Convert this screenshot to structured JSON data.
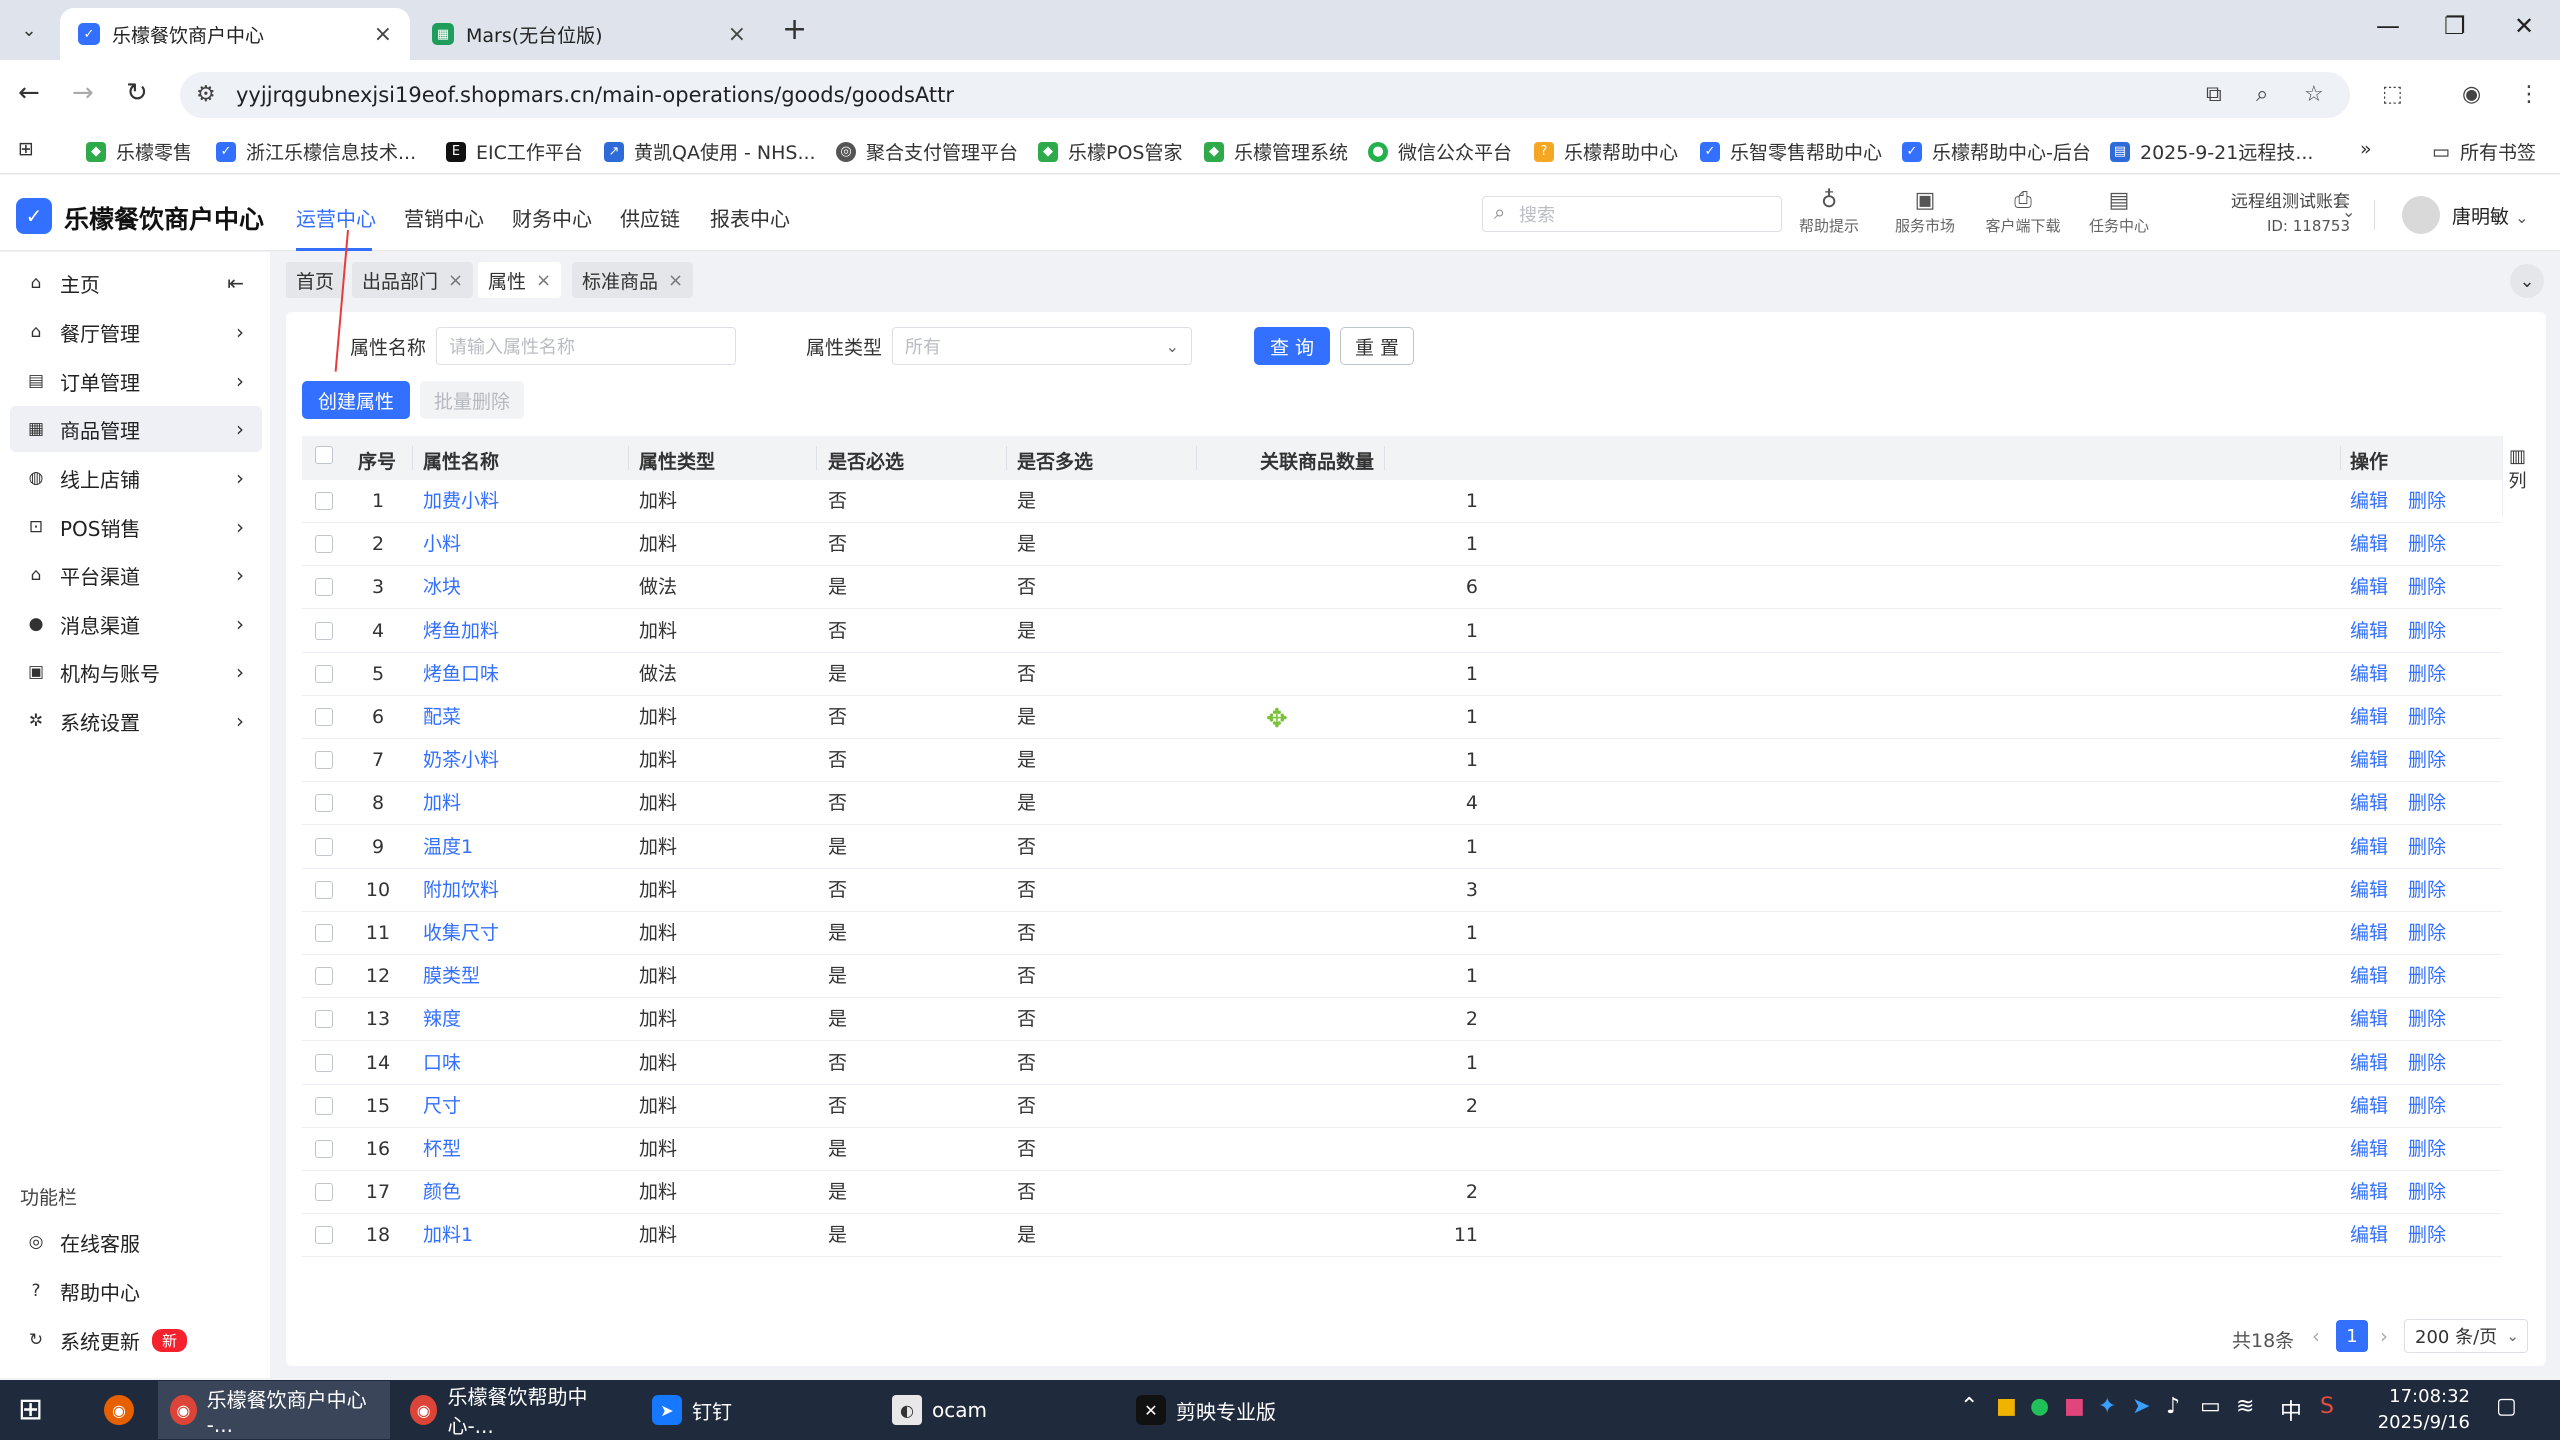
{
  "browser": {
    "tabs": [
      {
        "title": "乐檬餐饮商户中心",
        "active": true
      },
      {
        "title": "Mars(无台位版)",
        "active": false
      }
    ],
    "url": "yyjjrqgubnexjsi19eof.shopmars.cn/main-operations/goods/goodsAttr",
    "bookmarks": [
      "乐檬零售",
      "浙江乐檬信息技术...",
      "EIC工作平台",
      "黄凯QA使用 - NHS...",
      "聚合支付管理平台",
      "乐檬POS管家",
      "乐檬管理系统",
      "微信公众平台",
      "乐檬帮助中心",
      "乐智零售帮助中心",
      "乐檬帮助中心-后台",
      "2025-9-21远程技..."
    ],
    "all_bookmarks": "所有书签"
  },
  "app": {
    "name": "乐檬餐饮商户中心",
    "top_nav": [
      "运营中心",
      "营销中心",
      "财务中心",
      "供应链",
      "报表中心"
    ],
    "active_nav": "运营中心",
    "search_placeholder": "搜索",
    "tools": [
      "帮助提示",
      "服务市场",
      "客户端下载",
      "任务中心"
    ],
    "account_name": "远程组测试账套",
    "account_id": "ID: 118753",
    "user": "唐明敏"
  },
  "sidebar": {
    "items": [
      {
        "label": "主页",
        "icon": "home-icon"
      },
      {
        "label": "餐厅管理",
        "icon": "store-icon"
      },
      {
        "label": "订单管理",
        "icon": "order-icon"
      },
      {
        "label": "商品管理",
        "icon": "goods-icon",
        "active": true
      },
      {
        "label": "线上店铺",
        "icon": "globe-icon"
      },
      {
        "label": "POS销售",
        "icon": "cart-icon"
      },
      {
        "label": "平台渠道",
        "icon": "bank-icon"
      },
      {
        "label": "消息渠道",
        "icon": "chat-icon"
      },
      {
        "label": "机构与账号",
        "icon": "id-card-icon"
      },
      {
        "label": "系统设置",
        "icon": "gear-icon"
      }
    ],
    "section_title": "功能栏",
    "function_items": [
      {
        "label": "在线客服",
        "icon": "headset-icon"
      },
      {
        "label": "帮助中心",
        "icon": "help-icon"
      },
      {
        "label": "系统更新",
        "icon": "refresh-icon",
        "badge": "新"
      }
    ]
  },
  "tags": [
    {
      "label": "首页",
      "closable": false
    },
    {
      "label": "出品部门",
      "closable": true
    },
    {
      "label": "属性",
      "closable": true,
      "active": true
    },
    {
      "label": "标准商品",
      "closable": true
    }
  ],
  "filters": {
    "name_label": "属性名称",
    "name_placeholder": "请输入属性名称",
    "type_label": "属性类型",
    "type_value": "所有",
    "query_button": "查 询",
    "reset_button": "重 置"
  },
  "actions": {
    "create": "创建属性",
    "batch_delete": "批量删除"
  },
  "table": {
    "columns": [
      "序号",
      "属性名称",
      "属性类型",
      "是否必选",
      "是否多选",
      "关联商品数量",
      "操作"
    ],
    "column_toggle": "列",
    "edit_label": "编辑",
    "delete_label": "删除",
    "rows": [
      {
        "no": "1",
        "name": "加费小料",
        "type": "加料",
        "required": "否",
        "multi": "是",
        "count": "1"
      },
      {
        "no": "2",
        "name": "小料",
        "type": "加料",
        "required": "否",
        "multi": "是",
        "count": "1"
      },
      {
        "no": "3",
        "name": "冰块",
        "type": "做法",
        "required": "是",
        "multi": "否",
        "count": "6"
      },
      {
        "no": "4",
        "name": "烤鱼加料",
        "type": "加料",
        "required": "否",
        "multi": "是",
        "count": "1"
      },
      {
        "no": "5",
        "name": "烤鱼口味",
        "type": "做法",
        "required": "是",
        "multi": "否",
        "count": "1"
      },
      {
        "no": "6",
        "name": "配菜",
        "type": "加料",
        "required": "否",
        "multi": "是",
        "count": "1"
      },
      {
        "no": "7",
        "name": "奶茶小料",
        "type": "加料",
        "required": "否",
        "multi": "是",
        "count": "1"
      },
      {
        "no": "8",
        "name": "加料",
        "type": "加料",
        "required": "否",
        "multi": "是",
        "count": "4"
      },
      {
        "no": "9",
        "name": "温度1",
        "type": "加料",
        "required": "是",
        "multi": "否",
        "count": "1"
      },
      {
        "no": "10",
        "name": "附加饮料",
        "type": "加料",
        "required": "否",
        "multi": "否",
        "count": "3"
      },
      {
        "no": "11",
        "name": "收集尺寸",
        "type": "加料",
        "required": "是",
        "multi": "否",
        "count": "1"
      },
      {
        "no": "12",
        "name": "膜类型",
        "type": "加料",
        "required": "是",
        "multi": "否",
        "count": "1"
      },
      {
        "no": "13",
        "name": "辣度",
        "type": "加料",
        "required": "是",
        "multi": "否",
        "count": "2"
      },
      {
        "no": "14",
        "name": "口味",
        "type": "加料",
        "required": "否",
        "multi": "否",
        "count": "1"
      },
      {
        "no": "15",
        "name": "尺寸",
        "type": "加料",
        "required": "否",
        "multi": "否",
        "count": "2"
      },
      {
        "no": "16",
        "name": "杯型",
        "type": "加料",
        "required": "是",
        "multi": "否",
        "count": ""
      },
      {
        "no": "17",
        "name": "颜色",
        "type": "加料",
        "required": "是",
        "multi": "否",
        "count": "2"
      },
      {
        "no": "18",
        "name": "加料1",
        "type": "加料",
        "required": "是",
        "multi": "是",
        "count": "11"
      }
    ]
  },
  "pagination": {
    "total": "共18条",
    "current": "1",
    "page_size": "200 条/页"
  },
  "taskbar": {
    "apps": [
      "乐檬餐饮商户中心 -...",
      "乐檬餐饮帮助中心-...",
      "钉钉",
      "ocam",
      "剪映专业版"
    ],
    "ime": "中",
    "time": "17:08:32",
    "date": "2025/9/16"
  },
  "colors": {
    "accent": "#3370ff",
    "badge": "#f5222d",
    "taskbar": "#1f2a3c"
  }
}
